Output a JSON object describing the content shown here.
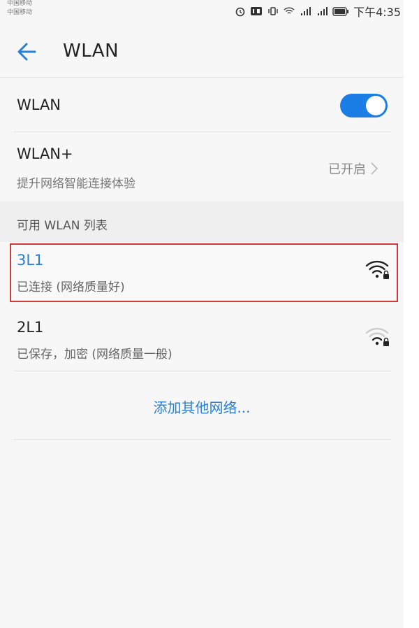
{
  "status_bar": {
    "carrier_1": "中国移动",
    "carrier_2": "中国移动",
    "time": "下午4:35"
  },
  "app_bar": {
    "title": "WLAN"
  },
  "wlan_toggle": {
    "label": "WLAN",
    "on": true,
    "accent": "#1a7ee6"
  },
  "wlan_plus": {
    "title": "WLAN+",
    "subtitle": "提升网络智能连接体验",
    "value": "已开启"
  },
  "available_section": {
    "title": "可用 WLAN 列表"
  },
  "networks": [
    {
      "ssid": "3L1",
      "status": "已连接 (网络质量好)",
      "ssid_color": "#2a80d6",
      "signal": "strong-locked-wifi-icon",
      "highlight_color": "#d43a3a"
    },
    {
      "ssid": "2L1",
      "status": "已保存，加密 (网络质量一般)",
      "ssid_color": "#222222",
      "signal": "medium-locked-wifi-icon"
    }
  ],
  "add_network": {
    "label": "添加其他网络..."
  }
}
